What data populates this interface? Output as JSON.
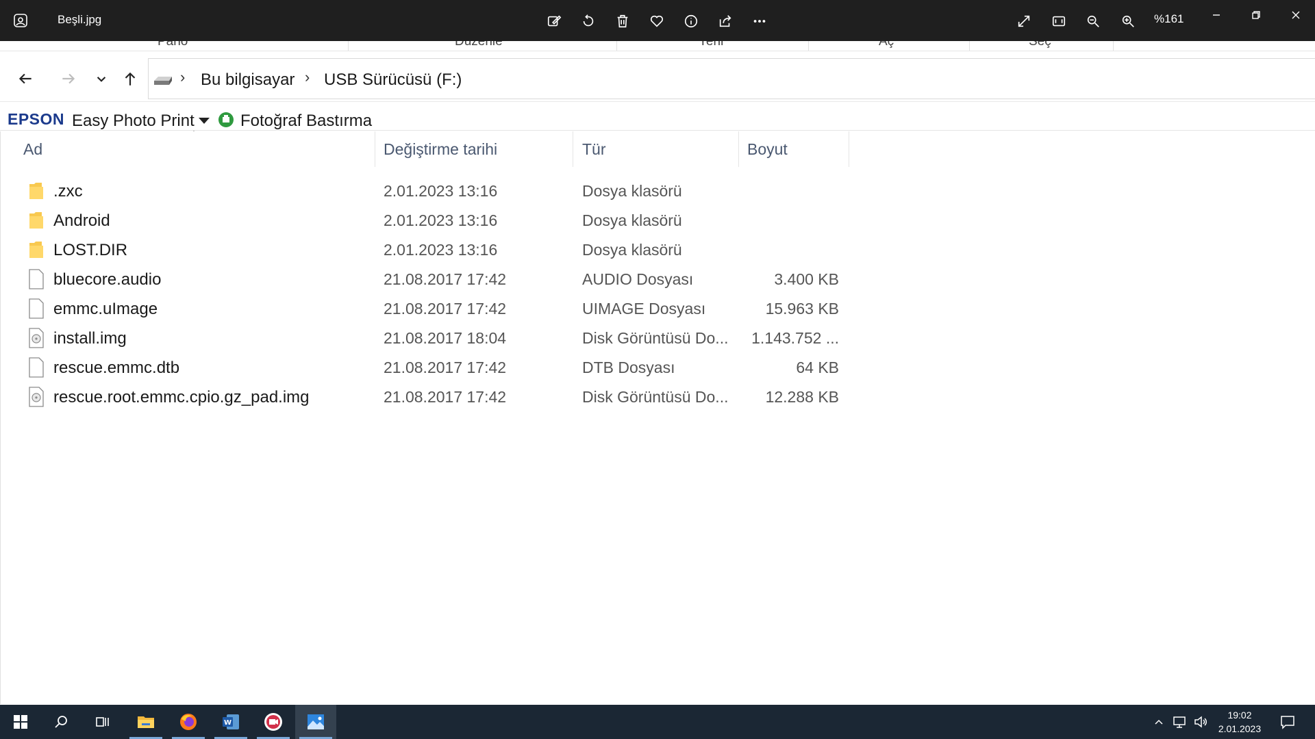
{
  "viewer": {
    "file_title": "Beşli.jpg",
    "zoom_label": "%161",
    "toolbar_icons": [
      "edit-icon",
      "rotate-icon",
      "delete-icon",
      "favorite-icon",
      "info-icon",
      "share-icon",
      "more-icon"
    ],
    "right_icons": [
      "fullscreen-icon",
      "fit-icon",
      "zoom-out-icon",
      "zoom-in-icon"
    ]
  },
  "explorer": {
    "ribbon_tabs": [
      "Pano",
      "Düzenle",
      "Yeni",
      "Aç",
      "Seç"
    ],
    "breadcrumb": [
      "Bu bilgisayar",
      "USB Sürücüsü (F:)"
    ],
    "epson": {
      "logo": "EPSON",
      "menu_label": "Easy Photo Print",
      "print_label": "Fotoğraf Bastırma"
    },
    "columns": {
      "name": "Ad",
      "date": "Değiştirme tarihi",
      "type": "Tür",
      "size": "Boyut"
    },
    "files": [
      {
        "name": ".zxc",
        "date": "2.01.2023 13:16",
        "type": "Dosya klasörü",
        "size": "",
        "icon": "folder-icon"
      },
      {
        "name": "Android",
        "date": "2.01.2023 13:16",
        "type": "Dosya klasörü",
        "size": "",
        "icon": "folder-icon"
      },
      {
        "name": "LOST.DIR",
        "date": "2.01.2023 13:16",
        "type": "Dosya klasörü",
        "size": "",
        "icon": "folder-icon"
      },
      {
        "name": "bluecore.audio",
        "date": "21.08.2017 17:42",
        "type": "AUDIO Dosyası",
        "size": "3.400 KB",
        "icon": "file-icon"
      },
      {
        "name": "emmc.uImage",
        "date": "21.08.2017 17:42",
        "type": "UIMAGE Dosyası",
        "size": "15.963 KB",
        "icon": "file-icon"
      },
      {
        "name": "install.img",
        "date": "21.08.2017 18:04",
        "type": "Disk Görüntüsü Do...",
        "size": "1.143.752 ...",
        "icon": "disk-image-icon"
      },
      {
        "name": "rescue.emmc.dtb",
        "date": "21.08.2017 17:42",
        "type": "DTB Dosyası",
        "size": "64 KB",
        "icon": "file-icon"
      },
      {
        "name": "rescue.root.emmc.cpio.gz_pad.img",
        "date": "21.08.2017 17:42",
        "type": "Disk Görüntüsü Do...",
        "size": "12.288 KB",
        "icon": "disk-image-icon"
      }
    ]
  },
  "taskbar": {
    "apps": [
      "start-icon",
      "search-icon",
      "task-view-icon",
      "file-explorer-icon",
      "firefox-icon",
      "word-icon",
      "screen-recorder-icon",
      "photos-icon"
    ],
    "time": "19:02",
    "date": "2.01.2023"
  }
}
